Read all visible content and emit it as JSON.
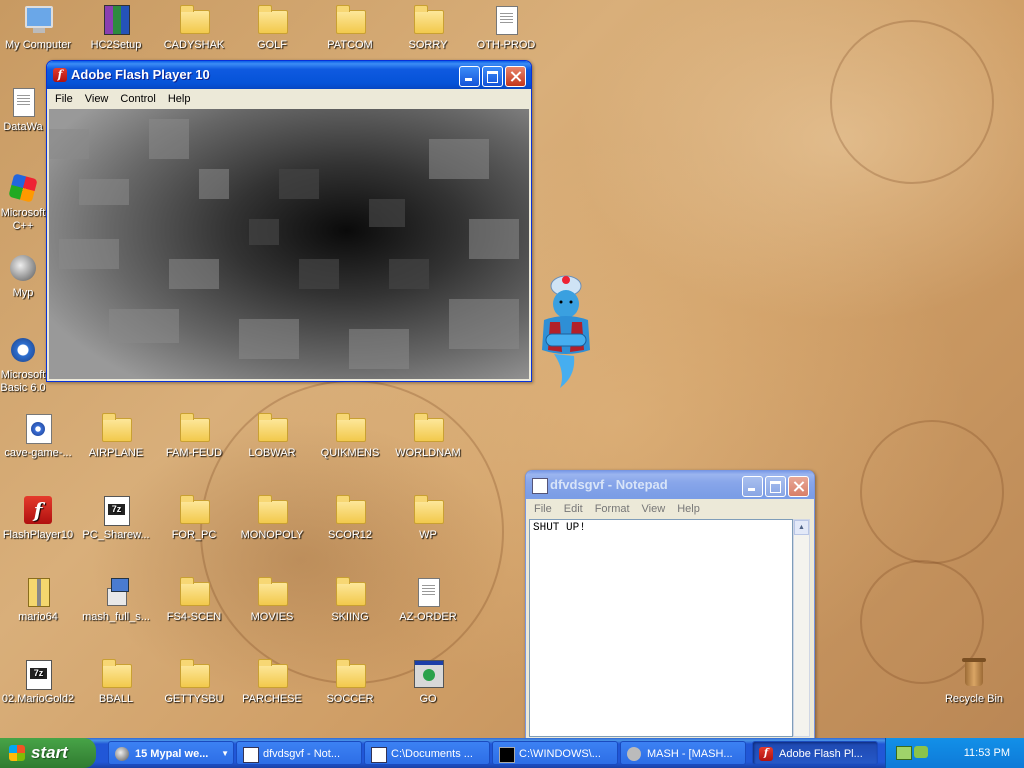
{
  "desktop": {
    "icons": [
      {
        "label": "My Computer",
        "icon": "my-computer-icon"
      },
      {
        "label": "HC2Setup",
        "icon": "winrar-archive-icon"
      },
      {
        "label": "CADYSHAK",
        "icon": "folder-icon"
      },
      {
        "label": "GOLF",
        "icon": "folder-icon"
      },
      {
        "label": "PATCOM",
        "icon": "folder-icon"
      },
      {
        "label": "SORRY",
        "icon": "folder-icon"
      },
      {
        "label": "OTH-PROD",
        "icon": "document-icon"
      },
      {
        "label": "DataWa",
        "icon": "shortcut-icon"
      },
      {
        "label": "Microsoft C++",
        "icon": "cpp-icon"
      },
      {
        "label": "Myp",
        "icon": "mypal-icon"
      },
      {
        "label": "Microsoft Basic 6.0",
        "icon": "vb6-icon"
      },
      {
        "label": "cave-game-...",
        "icon": "media-file-icon"
      },
      {
        "label": "AIRPLANE",
        "icon": "folder-icon"
      },
      {
        "label": "FAM-FEUD",
        "icon": "folder-icon"
      },
      {
        "label": "LOBWAR",
        "icon": "folder-icon"
      },
      {
        "label": "QUIKMENS",
        "icon": "folder-icon"
      },
      {
        "label": "WORLDNAM",
        "icon": "folder-icon"
      },
      {
        "label": "FlashPlayer10",
        "icon": "flash-player-icon"
      },
      {
        "label": "PC_Sharew...",
        "icon": "7z-archive-icon"
      },
      {
        "label": "FOR_PC",
        "icon": "folder-icon"
      },
      {
        "label": "MONOPOLY",
        "icon": "folder-icon"
      },
      {
        "label": "SCOR12",
        "icon": "folder-icon"
      },
      {
        "label": "WP",
        "icon": "folder-icon"
      },
      {
        "label": "mario64",
        "icon": "zip-archive-icon"
      },
      {
        "label": "mash_full_s...",
        "icon": "setup-icon"
      },
      {
        "label": "FS4-SCEN",
        "icon": "folder-icon"
      },
      {
        "label": "MOVIES",
        "icon": "folder-icon"
      },
      {
        "label": "SKIING",
        "icon": "folder-icon"
      },
      {
        "label": "AZ-ORDER",
        "icon": "document-icon"
      },
      {
        "label": "02.MarioGold2",
        "icon": "7z-archive-icon"
      },
      {
        "label": "BBALL",
        "icon": "folder-icon"
      },
      {
        "label": "GETTYSBU",
        "icon": "folder-icon"
      },
      {
        "label": "PARCHESE",
        "icon": "folder-icon"
      },
      {
        "label": "SOCCER",
        "icon": "folder-icon"
      },
      {
        "label": "GO",
        "icon": "program-window-icon"
      },
      {
        "label": "Recycle Bin",
        "icon": "recycle-bin-icon"
      }
    ]
  },
  "flash_window": {
    "title": "Adobe Flash Player 10",
    "menu": [
      "File",
      "View",
      "Control",
      "Help"
    ]
  },
  "notepad_window": {
    "title": "dfvdsgvf - Notepad",
    "menu": [
      "File",
      "Edit",
      "Format",
      "View",
      "Help"
    ],
    "content": "SHUT UP!"
  },
  "taskbar": {
    "start_label": "start",
    "tasks": [
      {
        "label": "15 Mypal we...",
        "icon": "mypal-icon"
      },
      {
        "label": "dfvdsgvf - Not...",
        "icon": "notepad-icon"
      },
      {
        "label": "C:\\Documents ...",
        "icon": "7z-archive-icon"
      },
      {
        "label": "C:\\WINDOWS\\...",
        "icon": "command-prompt-icon"
      },
      {
        "label": "MASH - [MASH...",
        "icon": "mash-icon"
      },
      {
        "label": "Adobe Flash Pl...",
        "icon": "flash-player-icon"
      }
    ],
    "clock": "11:53 PM"
  },
  "colors": {
    "xp_blue": "#2157d7",
    "start_green": "#3c8f3c",
    "tray_blue": "#0e7ad8",
    "window_face": "#ece9d8"
  }
}
